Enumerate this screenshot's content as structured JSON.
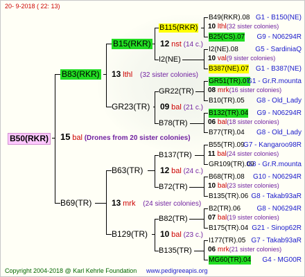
{
  "date": "20- 9-2018 ( 22: 13)",
  "root": {
    "name": "B50(RKR)",
    "number": "15",
    "abbr": "bal",
    "note": "(Drones from 20 sister colonies)"
  },
  "sire": {
    "name": "B83(RKR)",
    "number": "13",
    "abbr": "lthl",
    "note": "(32 sister colonies)"
  },
  "dam": {
    "name": "B69(TR)",
    "number": "13",
    "abbr": "mrk",
    "note": "(24 sister colonies)"
  },
  "g2": [
    {
      "name": "B15(RKR)",
      "number": "12",
      "abbr": "nst",
      "note": "(14 c.)"
    },
    {
      "name": "GR23(TR)",
      "number": "09",
      "abbr": "bal",
      "note": "(21 c.)"
    },
    {
      "name": "B63(TR)",
      "number": "12",
      "abbr": "bal",
      "note": "(24 c.)"
    },
    {
      "name": "B129(TR)",
      "number": "10",
      "abbr": "bal",
      "note": "(23 c.)"
    }
  ],
  "g3": [
    {
      "name": "B115(RKR)",
      "number": "10",
      "abbr": "lthl",
      "note": "(32 sister colonies)"
    },
    {
      "name": "I2(NE)",
      "number": "10",
      "abbr": "val",
      "note": "(9 sister colonies)"
    },
    {
      "name": "GR22(TR)",
      "number": "08",
      "abbr": "mrk",
      "note": "(16 sister colonies)"
    },
    {
      "name": "B78(TR)",
      "number": "06",
      "abbr": "bal",
      "note": "(18 sister colonies)"
    },
    {
      "name": "B137(TR)",
      "number": "11",
      "abbr": "bal",
      "note": "(24 sister colonies)"
    },
    {
      "name": "B72(TR)",
      "number": "10",
      "abbr": "bal",
      "note": "(23 sister colonies)"
    },
    {
      "name": "B82(TR)",
      "number": "07",
      "abbr": "bal",
      "note": "(19 sister colonies)"
    },
    {
      "name": "B135(TR)",
      "number": "06",
      "abbr": "mrk",
      "note": "(21 sister colonies)"
    }
  ],
  "g4": [
    {
      "name": "B49(RKR).08",
      "code": "G1 - B150(NE)"
    },
    {
      "name": "B25(CS).07",
      "code": "G9 - N06294R"
    },
    {
      "name": "I2(NE).08",
      "code": "G5 - SardiniaQ"
    },
    {
      "name": "B387(NE).07",
      "code": "G1 - B387(NE)"
    },
    {
      "name": "GR51(TR).07",
      "code": "G1 - Gr.R.mounta"
    },
    {
      "name": "B10(TR).05",
      "code": "G8 - Old_Lady"
    },
    {
      "name": "B132(TR).04",
      "code": "G9 - N06294R"
    },
    {
      "name": "B77(TR).04",
      "code": "G8 - Old_Lady"
    },
    {
      "name": "B55(TR).09",
      "code": "G7 - Kangaroo98R"
    },
    {
      "name": "GR109(TR).09",
      "code": "G3 - Gr.R.mounta"
    },
    {
      "name": "B68(TR).08",
      "code": "G10 - N06294R"
    },
    {
      "name": "B135(TR).06",
      "code": "G8 - Takab93aR"
    },
    {
      "name": "B2(TR).06",
      "code": "G8 - N06294R"
    },
    {
      "name": "B175(TR).04",
      "code": "G21 - Sinop62R"
    },
    {
      "name": "I177(TR).05",
      "code": "G7 - Takab93aR"
    },
    {
      "name": "MG60(TR).04",
      "code": "G4 - MG00R"
    }
  ],
  "footer": {
    "copyright": "Copyright 2004-2018 @ Karl Kehrle Foundation",
    "url": "www.pedigreeapis.org"
  },
  "colors": {
    "root_bg": "#ffc8ff",
    "green_bg": "#22dd22",
    "yellow_bg": "#ffff00"
  }
}
